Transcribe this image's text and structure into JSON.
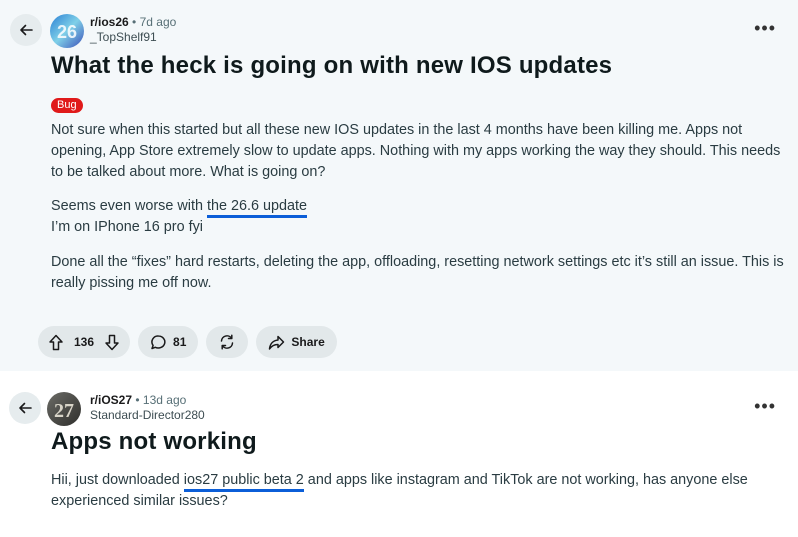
{
  "posts": [
    {
      "subreddit": "r/ios26",
      "age": "7d ago",
      "author": "_TopShelf91",
      "title": "What the heck is going on with new IOS updates",
      "flair": "Bug",
      "paragraphs": [
        "Not sure when this started but all these new IOS updates in the last 4 months have been killing me. Apps not opening, App Store extremely slow to update apps. Nothing with my apps working the way they should. This needs to be talked about more. What is going on?",
        "I’m on IPhone 16 pro fyi",
        "Done all the “fixes” hard restarts, deleting the app, offloading, resetting network settings etc it’s still an issue. This is really pissing me off now."
      ],
      "p2_prefix": "Seems even worse with ",
      "p2_highlight": "the 26.6 update",
      "upvotes": "136",
      "comments": "81",
      "share_label": "Share"
    },
    {
      "subreddit": "r/iOS27",
      "age": "13d ago",
      "author": "Standard-Director280",
      "title": "Apps not working",
      "body_prefix": "Hii, just downloaded ",
      "body_highlight": "ios27 public beta 2",
      "body_suffix": " and apps like instagram and TikTok are not working, has anyone else experienced similar issues?"
    }
  ],
  "icons": {
    "back": "arrow-left-icon",
    "more": "more-horizontal-icon",
    "upvote": "arrow-up-icon",
    "downvote": "arrow-down-icon",
    "comment": "comment-bubble-icon",
    "crosspost": "refresh-icon",
    "share": "share-arrow-icon"
  },
  "colors": {
    "post_bg": "#f4f8fa",
    "flair": "#e01a1a",
    "underline": "#0b5ed8",
    "pill": "#e2e8ea"
  }
}
